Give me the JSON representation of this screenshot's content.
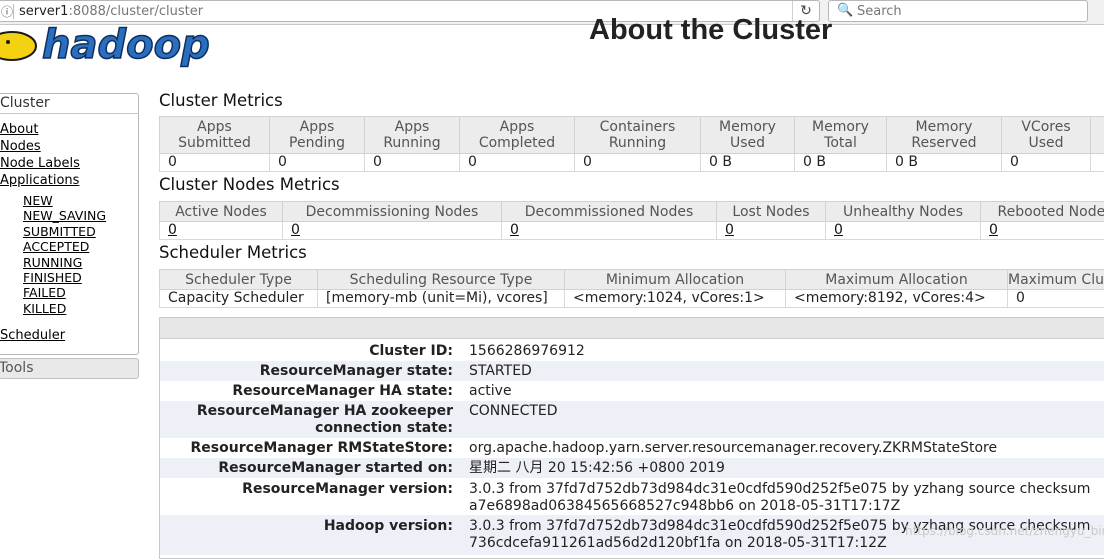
{
  "browser": {
    "url_host": "server1",
    "url_rest": ":8088/cluster/cluster",
    "search_placeholder": "Search"
  },
  "header": {
    "logo_text": "hadoop",
    "title": "About the Cluster"
  },
  "nav": {
    "header": "Cluster",
    "items": [
      "About",
      "Nodes",
      "Node Labels",
      "Applications"
    ],
    "app_states": [
      "NEW",
      "NEW_SAVING",
      "SUBMITTED",
      "ACCEPTED",
      "RUNNING",
      "FINISHED",
      "FAILED",
      "KILLED"
    ],
    "scheduler": "Scheduler",
    "tools": "Tools"
  },
  "cluster_metrics": {
    "title": "Cluster Metrics",
    "headers": [
      [
        "Apps",
        "Submitted"
      ],
      [
        "Apps",
        "Pending"
      ],
      [
        "Apps",
        "Running"
      ],
      [
        "Apps",
        "Completed"
      ],
      [
        "Containers",
        "Running"
      ],
      [
        "Memory",
        "Used"
      ],
      [
        "Memory",
        "Total"
      ],
      [
        "Memory",
        "Reserved"
      ],
      [
        "VCores",
        "Used"
      ],
      [
        "",
        ""
      ]
    ],
    "values": [
      "0",
      "0",
      "0",
      "0",
      "0",
      "0 B",
      "0 B",
      "0 B",
      "0",
      ""
    ]
  },
  "node_metrics": {
    "title": "Cluster Nodes Metrics",
    "headers": [
      "Active Nodes",
      "Decommissioning Nodes",
      "Decommissioned Nodes",
      "Lost Nodes",
      "Unhealthy Nodes",
      "Rebooted Nodes"
    ],
    "values": [
      "0",
      "0",
      "0",
      "0",
      "0",
      "0"
    ]
  },
  "scheduler_metrics": {
    "title": "Scheduler Metrics",
    "headers": [
      "Scheduler Type",
      "Scheduling Resource Type",
      "Minimum Allocation",
      "Maximum Allocation",
      "Maximum Cluster Application Priority"
    ],
    "values": [
      "Capacity Scheduler",
      "[memory-mb (unit=Mi), vcores]",
      "<memory:1024, vCores:1>",
      "<memory:8192, vCores:4>",
      "0"
    ]
  },
  "cluster_info": [
    {
      "key": "Cluster ID:",
      "value": "1566286976912"
    },
    {
      "key": "ResourceManager state:",
      "value": "STARTED"
    },
    {
      "key": "ResourceManager HA state:",
      "value": "active"
    },
    {
      "key": "ResourceManager HA zookeeper connection state:",
      "value": "CONNECTED"
    },
    {
      "key": "ResourceManager RMStateStore:",
      "value": "org.apache.hadoop.yarn.server.resourcemanager.recovery.ZKRMStateStore"
    },
    {
      "key": "ResourceManager started on:",
      "value": "星期二 八月 20 15:42:56 +0800 2019"
    },
    {
      "key": "ResourceManager version:",
      "value": "3.0.3 from 37fd7d752db73d984dc31e0cdfd590d252f5e075 by yzhang source checksum a7e6898ad06384565668527c948bb6 on 2018-05-31T17:17Z"
    },
    {
      "key": "Hadoop version:",
      "value": "3.0.3 from 37fd7d752db73d984dc31e0cdfd590d252f5e075 by yzhang source checksum 736cdcefa911261ad56d2d120bf1fa on 2018-05-31T17:12Z"
    }
  ],
  "watermark": "https://blog.csdn.net/zhengyu_bing",
  "colors": {
    "table_header_bg": "#ececec",
    "alt_row_bg": "#eef0f8",
    "logo_yellow": "#f5d211",
    "logo_blue": "#2a6fbf"
  }
}
